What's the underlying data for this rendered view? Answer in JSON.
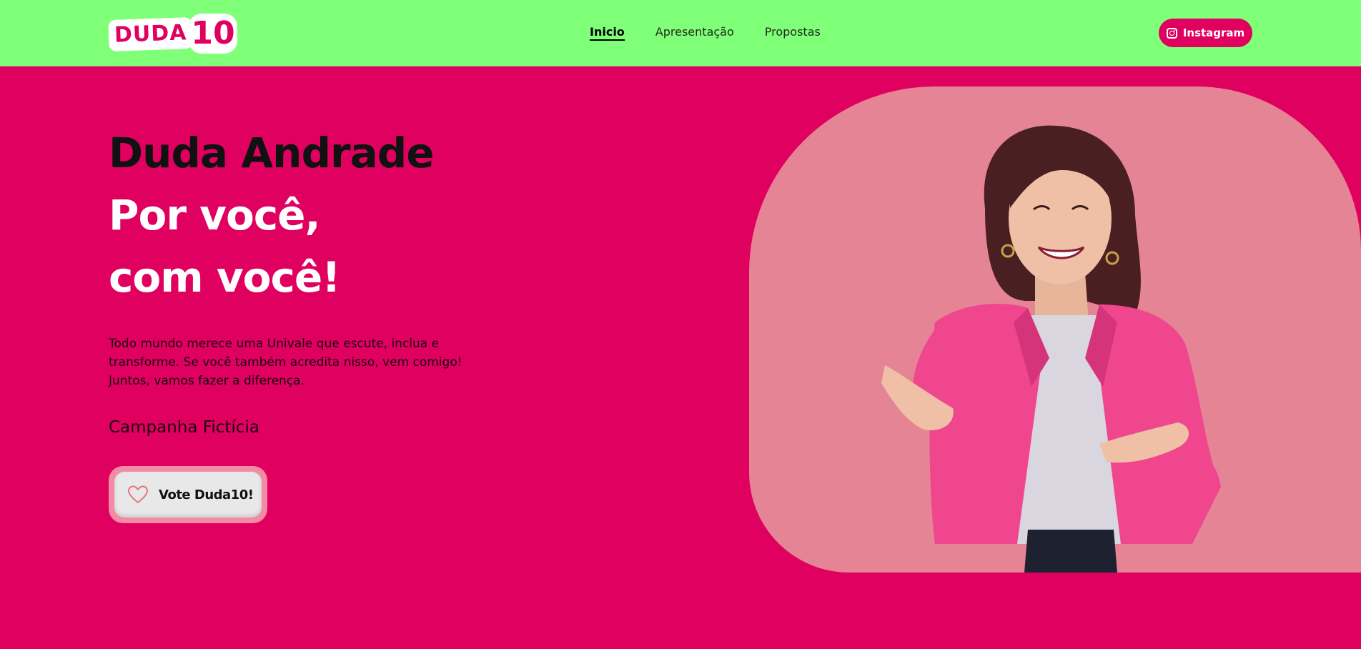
{
  "header": {
    "logo": {
      "text": "DUDA",
      "number": "10"
    },
    "nav": [
      {
        "label": "Inicio",
        "active": true
      },
      {
        "label": "Apresentação",
        "active": false
      },
      {
        "label": "Propostas",
        "active": false
      }
    ],
    "instagram_label": "Instagram"
  },
  "hero": {
    "name": "Duda Andrade",
    "slogan_line1": "Por você,",
    "slogan_line2": "com você!",
    "description": "Todo mundo merece uma Univale que escute, inclua e transforme. Se você também acredita nisso, vem comigo! Juntos, vamos fazer a diferença.",
    "campaign_note": "Campanha Fictícia",
    "vote_button_label": "Vote Duda10!"
  },
  "icons": {
    "instagram": "instagram-icon",
    "vote": "heart-icon"
  },
  "colors": {
    "header_bg": "#80ff78",
    "page_bg": "#e0005f",
    "panel_bg": "#e48495",
    "button_accent": "#e0005f"
  }
}
